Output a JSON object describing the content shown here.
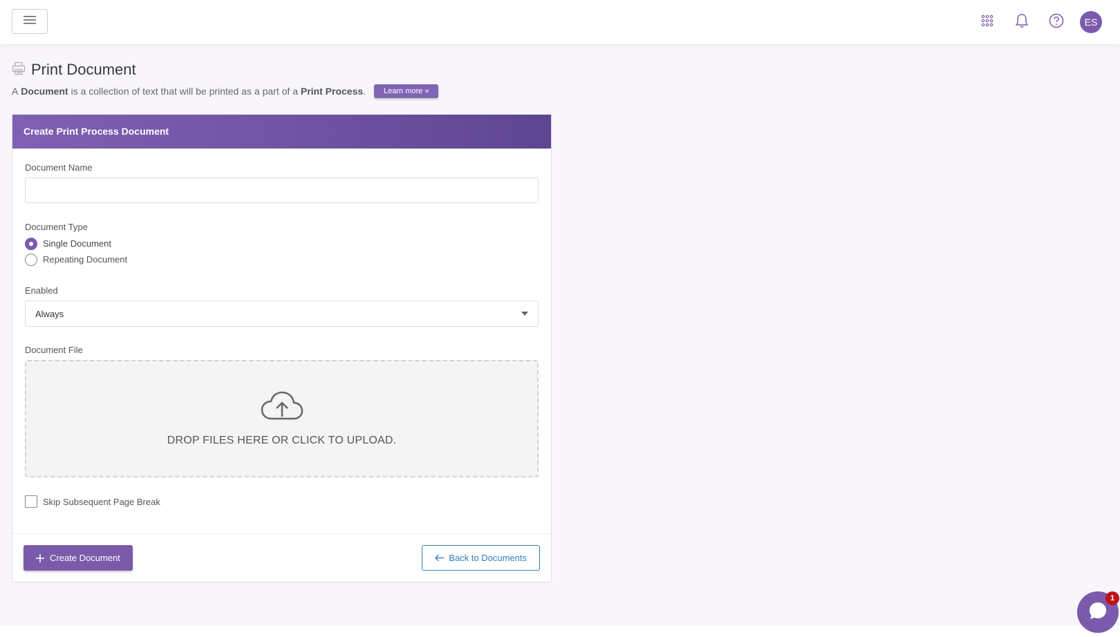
{
  "header": {
    "menu_icon": "hamburger-icon",
    "apps_icon": "apps-grid-icon",
    "notifications_icon": "bell-icon",
    "help_icon": "help-circle-icon",
    "avatar_initials": "ES"
  },
  "page": {
    "icon": "printer-icon",
    "title": "Print Document",
    "subtitle": {
      "prefix": "A",
      "term": "Document",
      "middle": "is a collection of text that will be printed as a part of a",
      "process": "Print Process",
      "suffix": "."
    },
    "learn_more": "Learn more »"
  },
  "form": {
    "card_title": "Create Print Process Document",
    "document_name": {
      "label": "Document Name",
      "value": "",
      "placeholder": ""
    },
    "document_type": {
      "label": "Document Type",
      "options": [
        {
          "label": "Single Document",
          "checked": true
        },
        {
          "label": "Repeating Document",
          "checked": false
        }
      ]
    },
    "enabled": {
      "label": "Enabled",
      "selected": "Always"
    },
    "document_file": {
      "label": "Document File",
      "upload_icon": "cloud-upload-icon",
      "dropzone_text": "DROP FILES HERE OR CLICK TO UPLOAD."
    },
    "skip_page_break": {
      "label": "Skip Subsequent Page Break",
      "checked": false
    },
    "create_button": "Create Document",
    "back_button": "Back to Documents"
  },
  "chat": {
    "icon": "chat-bubble-icon",
    "badge_count": "1"
  },
  "colors": {
    "brand_purple": "#7b5aab",
    "link_blue": "#2d7fc1",
    "badge_red": "#c0121a"
  }
}
